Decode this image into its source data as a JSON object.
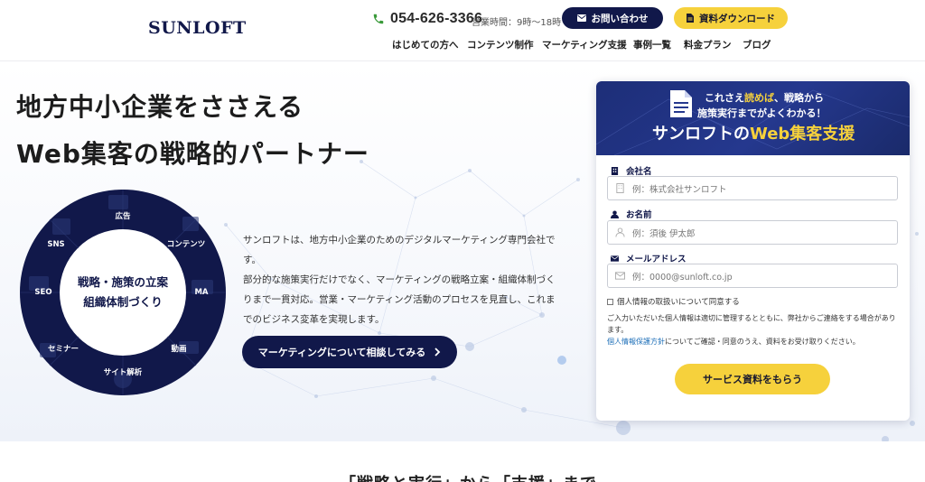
{
  "header": {
    "logo": "SUNLOFT",
    "phone": "054-626-3366",
    "hours": "営業時間：9時〜18時",
    "contact_label": "お問い合わせ",
    "download_label": "資料ダウンロード",
    "nav": [
      "はじめての方へ",
      "コンテンツ制作",
      "マーケティング支援",
      "事例一覧",
      "料金プラン",
      "ブログ"
    ]
  },
  "hero": {
    "headline_1": "地方中小企業をささえる",
    "headline_2": "Web集客の戦略的パートナー",
    "description_1": "サンロフトは、地方中小企業のためのデジタルマーケティング専門会社です。",
    "description_2": "部分的な施策実行だけでなく、マーケティングの戦略立案・組織体制づくりまで一貫対応。営業・マーケティング活動のプロセスを見直し、これまでのビジネス変革を実現します。",
    "cta_label": "マーケティングについて相談してみる"
  },
  "ring": {
    "center_line_1": "戦略・施策の立案",
    "center_line_2": "組織体制づくり",
    "items": [
      "広告",
      "コンテンツ",
      "MA",
      "動画",
      "サイト解析",
      "セミナー",
      "SEO",
      "SNS"
    ]
  },
  "form": {
    "head_line_1_a": "これさえ",
    "head_line_1_b": "読めば",
    "head_line_1_c": "、戦略から",
    "head_line_2": "施策実行までがよくわかる！",
    "head_line_3_a": "サンロフトの",
    "head_line_3_b": "Web集客支援",
    "company_label": "会社名",
    "company_placeholder": "例：株式会社サンロフト",
    "name_label": "お名前",
    "name_placeholder": "例：須後 伊太郎",
    "email_label": "メールアドレス",
    "email_placeholder": "例：0000@sunloft.co.jp",
    "consent_label": "個人情報の取扱いについて同意する",
    "note_1": "ご入力いただいた個人情報は適切に管理するとともに、弊社からご連絡をする場合があります。",
    "note_link": "個人情報保護方針",
    "note_2": "についてご確認・同意のうえ、資料をお受け取りください。",
    "submit_label": "サービス資料をもらう"
  },
  "next_section_title": "「戦略と実行」から「支援」まで",
  "colors": {
    "navy": "#11184a",
    "yellow": "#f6d13c",
    "green": "#3a9a3a",
    "link": "#1e6fb8"
  }
}
